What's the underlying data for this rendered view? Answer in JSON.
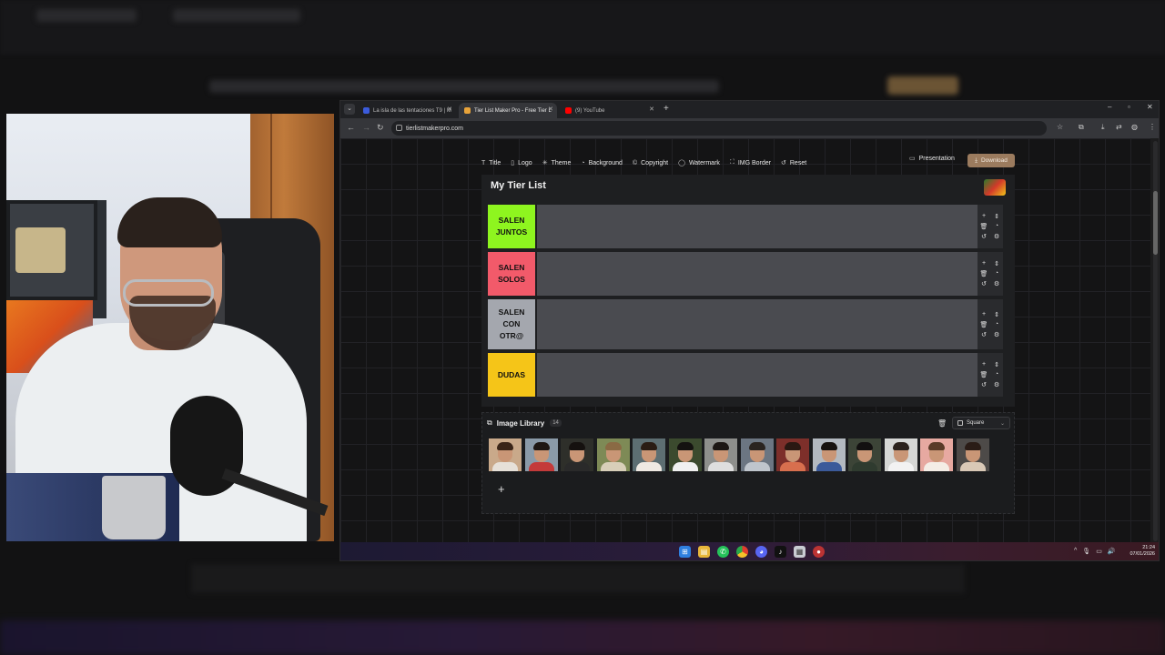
{
  "browser": {
    "tabs": [
      {
        "label": "La isla de las tentaciones T9 | M",
        "favicon_color": "#3b5bdb"
      },
      {
        "label": "Tier List Maker Pro - Free Tier L",
        "favicon_color": "#e8a33a",
        "active": true
      },
      {
        "label": "(9) YouTube",
        "favicon_color": "#ff0000"
      }
    ],
    "url": "tierlistmakerpro.com"
  },
  "toolbar": {
    "items": [
      "Title",
      "Logo",
      "Theme",
      "Background",
      "Copyright",
      "Watermark",
      "IMG Border",
      "Reset"
    ],
    "presentation_label": "Presentation",
    "download_label": "Download",
    "download_color": "#9b7b5e"
  },
  "tierlist": {
    "title": "My Tier List",
    "tiers": [
      {
        "lines": [
          "SALEN",
          "JUNTOS"
        ],
        "color": "#8ef51f"
      },
      {
        "lines": [
          "SALEN",
          "SOLOS"
        ],
        "color": "#f25a6a"
      },
      {
        "lines": [
          "SALEN",
          "CON",
          "OTR@"
        ],
        "color": "#a4a7ae"
      },
      {
        "lines": [
          "DUDAS"
        ],
        "color": "#f5c518"
      }
    ]
  },
  "library": {
    "title": "Image Library",
    "count": "14",
    "shape_option": "Square",
    "thumbnails": [
      {
        "bg": "#c9a98a",
        "hair": "#3a2518",
        "shirt": "#e6e0d8"
      },
      {
        "bg": "#8a9aa8",
        "hair": "#1e1714",
        "shirt": "#c43a3a"
      },
      {
        "bg": "#2e2f2a",
        "hair": "#15110f",
        "shirt": "#2a2a2a"
      },
      {
        "bg": "#7e8a56",
        "hair": "#8a6a44",
        "shirt": "#d8cfb9"
      },
      {
        "bg": "#5d6e72",
        "hair": "#2a1c14",
        "shirt": "#efe9e2"
      },
      {
        "bg": "#3b4a2e",
        "hair": "#141210",
        "shirt": "#f0f0f0"
      },
      {
        "bg": "#8e8f8c",
        "hair": "#1d1714",
        "shirt": "#dedede"
      },
      {
        "bg": "#6c7682",
        "hair": "#2a2420",
        "shirt": "#bfc5cc"
      },
      {
        "bg": "#7d2f2a",
        "hair": "#2a1812",
        "shirt": "#d86f4e"
      },
      {
        "bg": "#b3b9c0",
        "hair": "#17120f",
        "shirt": "#3b5a9a"
      },
      {
        "bg": "#3c4437",
        "hair": "#121010",
        "shirt": "#2f3b2f"
      },
      {
        "bg": "#d6d7d5",
        "hair": "#2b221c",
        "shirt": "#f2f2f2"
      },
      {
        "bg": "#e7a9a1",
        "hair": "#5a3a28",
        "shirt": "#f4ede6"
      },
      {
        "bg": "#4d4a48",
        "hair": "#2a1c16",
        "shirt": "#d9c8b6"
      }
    ]
  },
  "taskbar": {
    "time": "21:24",
    "date": "07/01/2026"
  }
}
